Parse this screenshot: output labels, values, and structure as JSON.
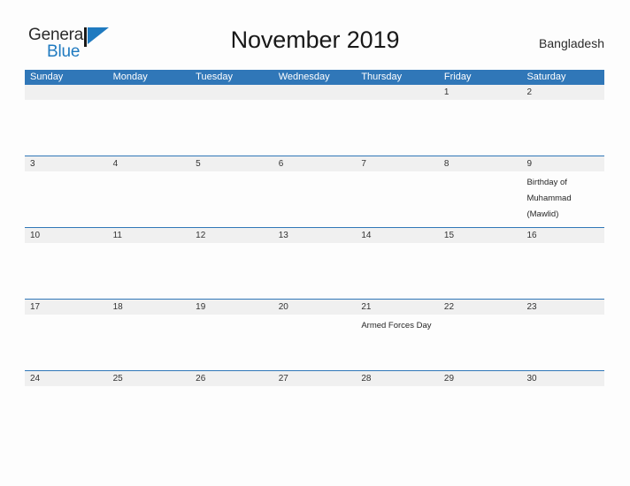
{
  "brand": {
    "name_part1": "General",
    "name_part2": "Blue",
    "mark": "triangle-flag-icon",
    "accent_color": "#1f7ac0"
  },
  "header": {
    "title": "November 2019",
    "country": "Bangladesh"
  },
  "theme": {
    "header_blue": "#3077b8",
    "date_band_gray": "#f0f0f0",
    "page_background": "#fdfdfd",
    "text_dark": "#333333"
  },
  "calendar": {
    "month": "November",
    "year": "2019",
    "weekday_headers": [
      "Sunday",
      "Monday",
      "Tuesday",
      "Wednesday",
      "Thursday",
      "Friday",
      "Saturday"
    ],
    "weeks": [
      {
        "dates": [
          "",
          "",
          "",
          "",
          "",
          "1",
          "2"
        ],
        "events": [
          "",
          "",
          "",
          "",
          "",
          "",
          ""
        ]
      },
      {
        "dates": [
          "3",
          "4",
          "5",
          "6",
          "7",
          "8",
          "9"
        ],
        "events": [
          "",
          "",
          "",
          "",
          "",
          "",
          "Birthday of Muhammad (Mawlid)"
        ]
      },
      {
        "dates": [
          "10",
          "11",
          "12",
          "13",
          "14",
          "15",
          "16"
        ],
        "events": [
          "",
          "",
          "",
          "",
          "",
          "",
          ""
        ]
      },
      {
        "dates": [
          "17",
          "18",
          "19",
          "20",
          "21",
          "22",
          "23"
        ],
        "events": [
          "",
          "",
          "",
          "",
          "Armed Forces Day",
          "",
          ""
        ]
      },
      {
        "dates": [
          "24",
          "25",
          "26",
          "27",
          "28",
          "29",
          "30"
        ],
        "events": [
          "",
          "",
          "",
          "",
          "",
          "",
          ""
        ]
      }
    ]
  }
}
